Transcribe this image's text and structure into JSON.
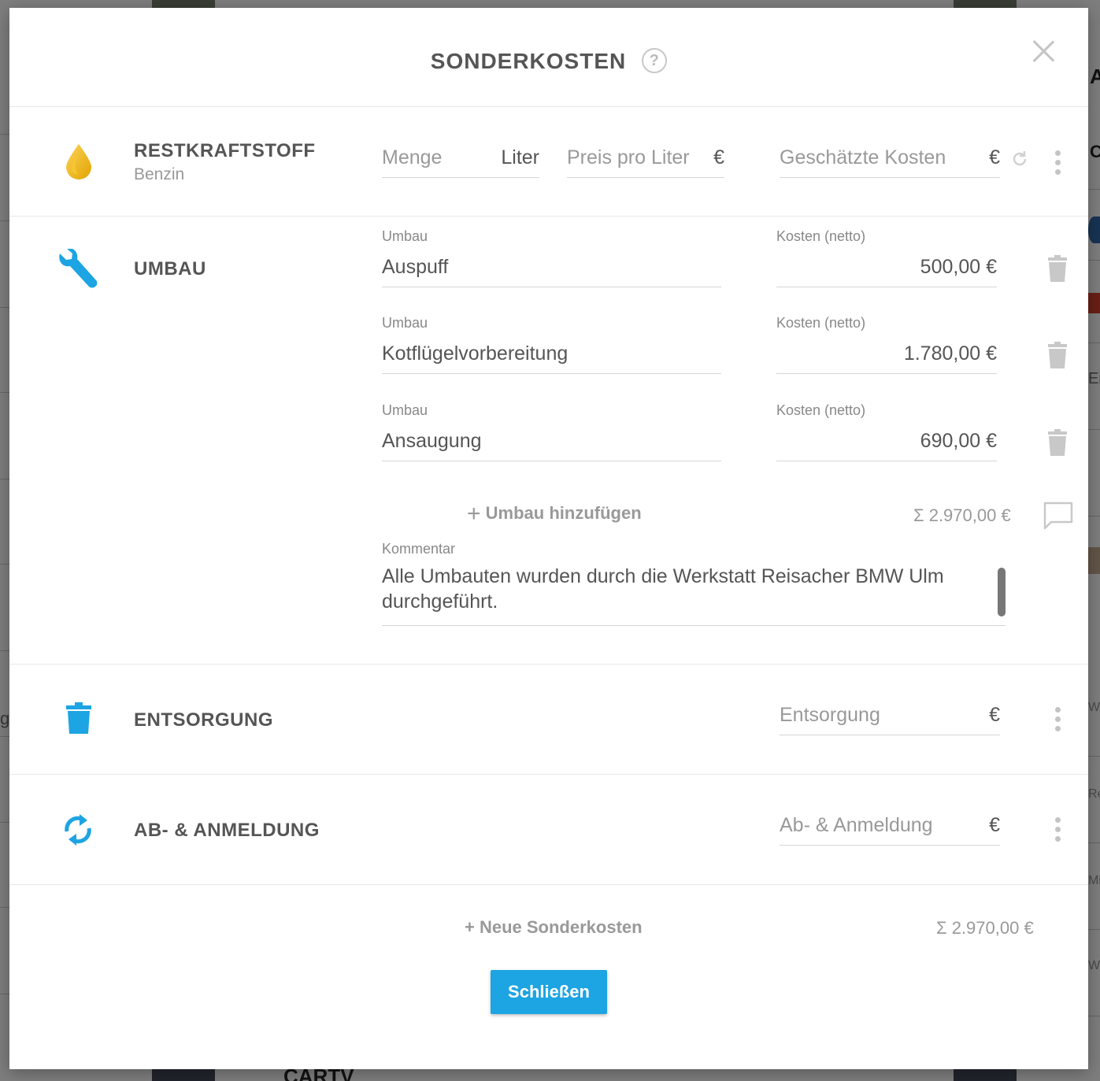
{
  "background": {
    "edge_letters": [
      "A",
      "C",
      "Ei",
      "g",
      "Wi",
      "Re",
      "Mi",
      "We"
    ],
    "footer_logo": "CARTV"
  },
  "modal": {
    "title": "SONDERKOSTEN",
    "help_icon": "?",
    "close_icon": "close-icon"
  },
  "restkraftstoff": {
    "title": "RESTKRAFTSTOFF",
    "subtitle": "Benzin",
    "icon": "fuel-drop-icon",
    "icon_color": "#f2b705",
    "menge_placeholder": "Menge",
    "menge_unit": "Liter",
    "preis_placeholder": "Preis pro Liter",
    "preis_unit": "€",
    "kosten_placeholder": "Geschätzte Kosten",
    "kosten_unit": "€"
  },
  "umbau": {
    "title": "UMBAU",
    "icon": "wrench-icon",
    "icon_color": "#1da4e3",
    "items": [
      {
        "label": "Umbau",
        "value": "Auspuff",
        "cost_label": "Kosten (netto)",
        "cost": "500,00 €"
      },
      {
        "label": "Umbau",
        "value": "Kotflügelvorbereitung",
        "cost_label": "Kosten (netto)",
        "cost": "1.780,00 €"
      },
      {
        "label": "Umbau",
        "value": "Ansaugung",
        "cost_label": "Kosten (netto)",
        "cost": "690,00 €"
      }
    ],
    "add_label": "Umbau hinzufügen",
    "sum": "Σ 2.970,00 €",
    "comment_label": "Kommentar",
    "comment_text": "Alle Umbauten wurden durch die Werkstatt Reisacher BMW Ulm durchgeführt."
  },
  "entsorgung": {
    "title": "ENTSORGUNG",
    "icon": "trash-icon",
    "icon_color": "#1da4e3",
    "placeholder": "Entsorgung",
    "unit": "€"
  },
  "anmeldung": {
    "title": "AB- & ANMELDUNG",
    "icon": "sync-icon",
    "icon_color": "#1da4e3",
    "placeholder": "Ab- & Anmeldung",
    "unit": "€"
  },
  "footer": {
    "add_label": "+ Neue Sonderkosten",
    "total": "Σ 2.970,00 €",
    "close_button": "Schließen"
  }
}
